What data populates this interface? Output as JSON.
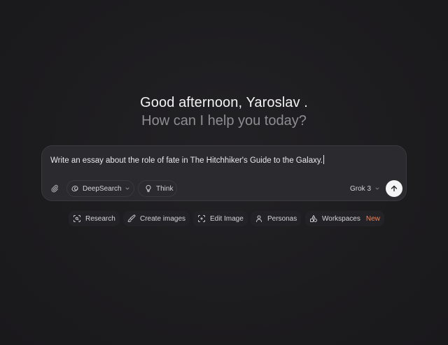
{
  "greeting": {
    "line1": "Good afternoon, Yaroslav .",
    "line2": "How can I help you today?"
  },
  "composer": {
    "text": "Write an essay about the role of fate in The Hitchhiker's Guide to the Galaxy.",
    "attach_icon": "paperclip-icon",
    "deepsearch_label": "DeepSearch",
    "deepsearch_icon": "deepsearch-swirl-icon",
    "think_label": "Think",
    "think_icon": "lightbulb-icon",
    "model_label": "Grok 3",
    "send_icon": "arrow-up-icon"
  },
  "quick_actions": {
    "research": {
      "label": "Research",
      "icon": "scan-search-icon"
    },
    "create_images": {
      "label": "Create images",
      "icon": "paintbrush-icon"
    },
    "edit_image": {
      "label": "Edit Image",
      "icon": "image-scan-icon"
    },
    "personas": {
      "label": "Personas",
      "icon": "person-icon"
    },
    "workspaces": {
      "label": "Workspaces",
      "badge": "New",
      "icon": "shapes-icon"
    }
  },
  "colors": {
    "background": "#1c1b1e",
    "composer_bg": "#2b2a2e",
    "text_primary": "#f2f2f4",
    "text_secondary": "#8e8d92",
    "new_badge": "#e7865f",
    "send_button": "#f4f4f6"
  }
}
